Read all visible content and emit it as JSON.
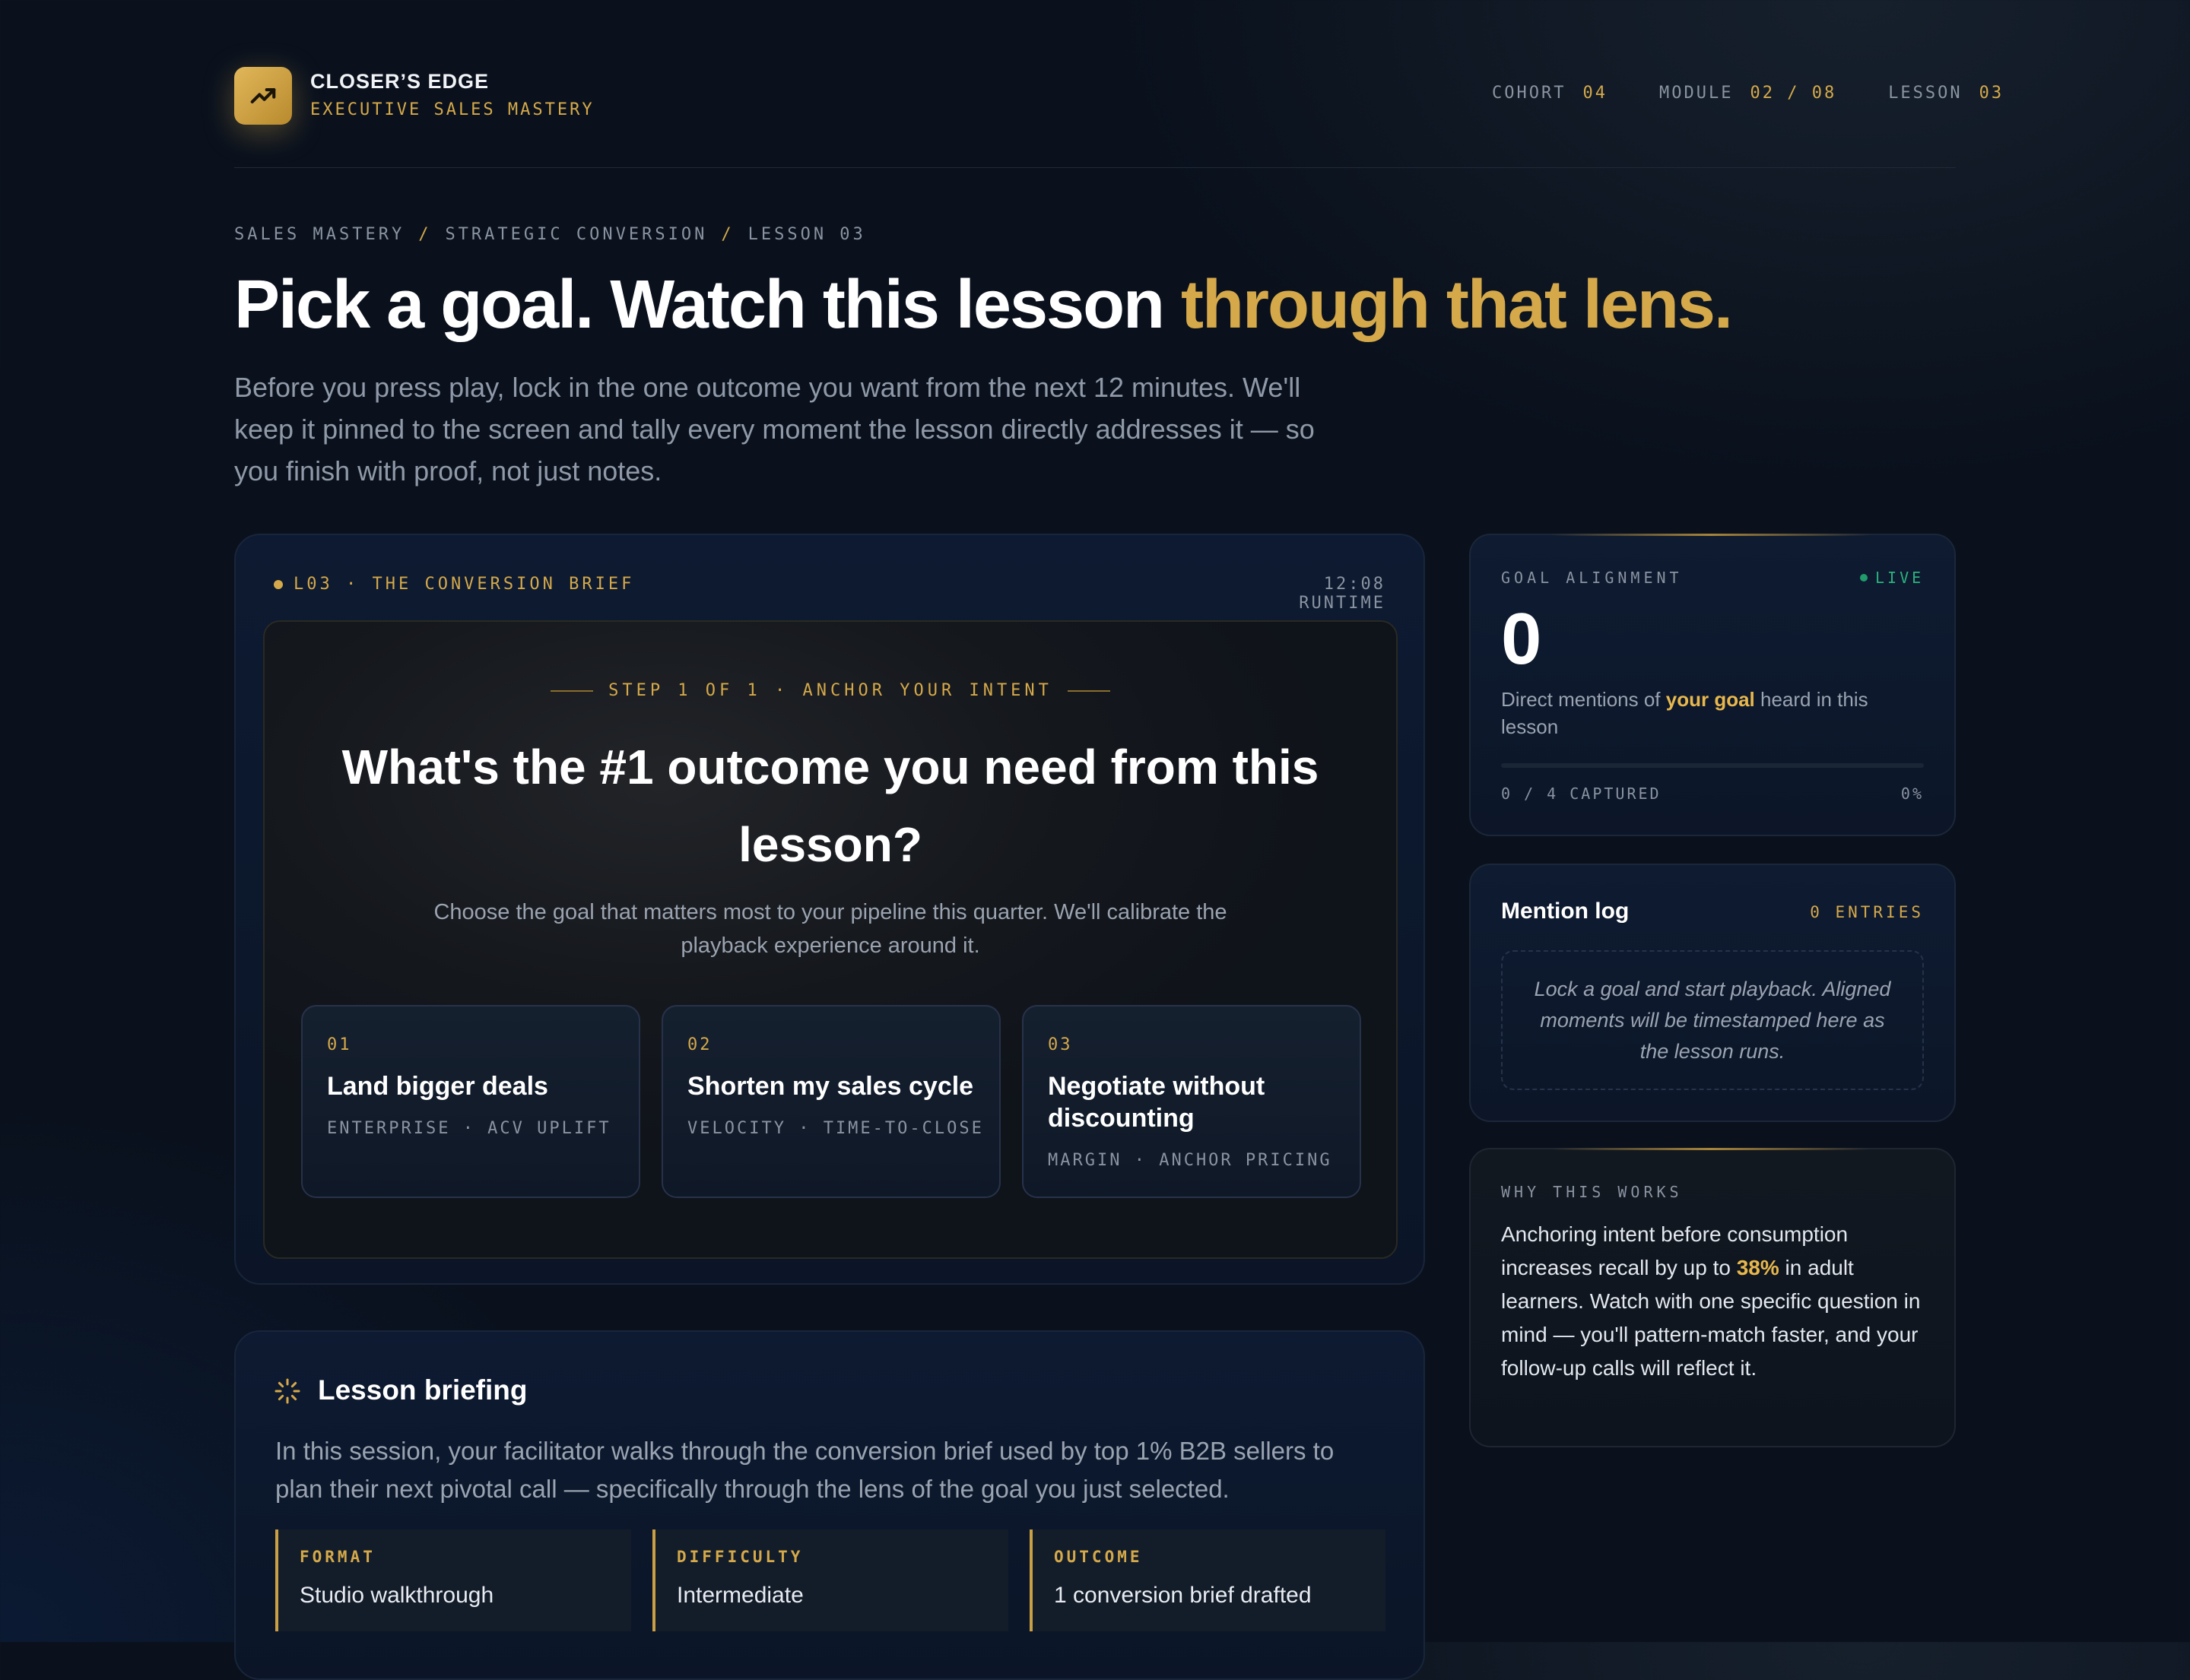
{
  "brand": {
    "name": "CLOSER’S EDGE",
    "subtitle": "EXECUTIVE SALES MASTERY",
    "logo_icon": "trending-up-icon",
    "accent": "#d5a94a"
  },
  "meta": [
    {
      "label": "COHORT",
      "value": "04"
    },
    {
      "label": "MODULE",
      "value": "02 / 08"
    },
    {
      "label": "LESSON",
      "value": "03"
    }
  ],
  "breadcrumb": [
    "SALES MASTERY",
    "STRATEGIC CONVERSION",
    "LESSON 03"
  ],
  "breadcrumb_sep": "/",
  "hero": {
    "title_main": "Pick a goal. Watch this lesson",
    "title_highlight": "through that lens.",
    "lead": "Before you press play, lock in the one outcome you want from the next 12 minutes. We'll keep it pinned to the screen and tally every moment the lesson directly addresses it — so you finish with proof, not just notes."
  },
  "player": {
    "tag": "L03 · THE CONVERSION BRIEF",
    "runtime": "12:08 RUNTIME",
    "step": "STEP 1 OF 1 · ANCHOR YOUR INTENT",
    "question": "What's the #1 outcome you need from this lesson?",
    "subtitle": "Choose the goal that matters most to your pipeline this quarter. We'll calibrate the playback experience around it.",
    "options": [
      {
        "num": "01",
        "title": "Land bigger deals",
        "tags": "ENTERPRISE · ACV UPLIFT"
      },
      {
        "num": "02",
        "title": "Shorten my sales cycle",
        "tags": "VELOCITY · TIME-TO-CLOSE"
      },
      {
        "num": "03",
        "title": "Negotiate without discounting",
        "tags": "MARGIN · ANCHOR PRICING"
      }
    ]
  },
  "briefing": {
    "title": "Lesson briefing",
    "icon": "loader-icon",
    "text": "In this session, your facilitator walks through the conversion brief used by top 1% B2B sellers to plan their next pivotal call — specifically through the lens of the goal you just selected.",
    "items": [
      {
        "label": "FORMAT",
        "value": "Studio walkthrough"
      },
      {
        "label": "DIFFICULTY",
        "value": "Intermediate"
      },
      {
        "label": "OUTCOME",
        "value": "1 conversion brief drafted"
      }
    ]
  },
  "goal_alignment": {
    "label": "GOAL ALIGNMENT",
    "status": "LIVE",
    "count": "0",
    "desc_prefix": "Direct mentions of ",
    "desc_highlight": "your goal",
    "desc_suffix": " heard in this lesson",
    "captured": "0 / 4 CAPTURED",
    "percent": "0%",
    "progress": 0
  },
  "mention_log": {
    "title": "Mention log",
    "count": "0 ENTRIES",
    "empty": "Lock a goal and start playback. Aligned moments will be timestamped here as the lesson runs."
  },
  "why": {
    "label": "WHY THIS WORKS",
    "text_a": "Anchoring intent before consumption increases recall by up to ",
    "stat": "38%",
    "text_b": " in adult learners. Watch with one specific question in mind — you'll pattern-match faster, and your follow-up calls will reflect it."
  }
}
